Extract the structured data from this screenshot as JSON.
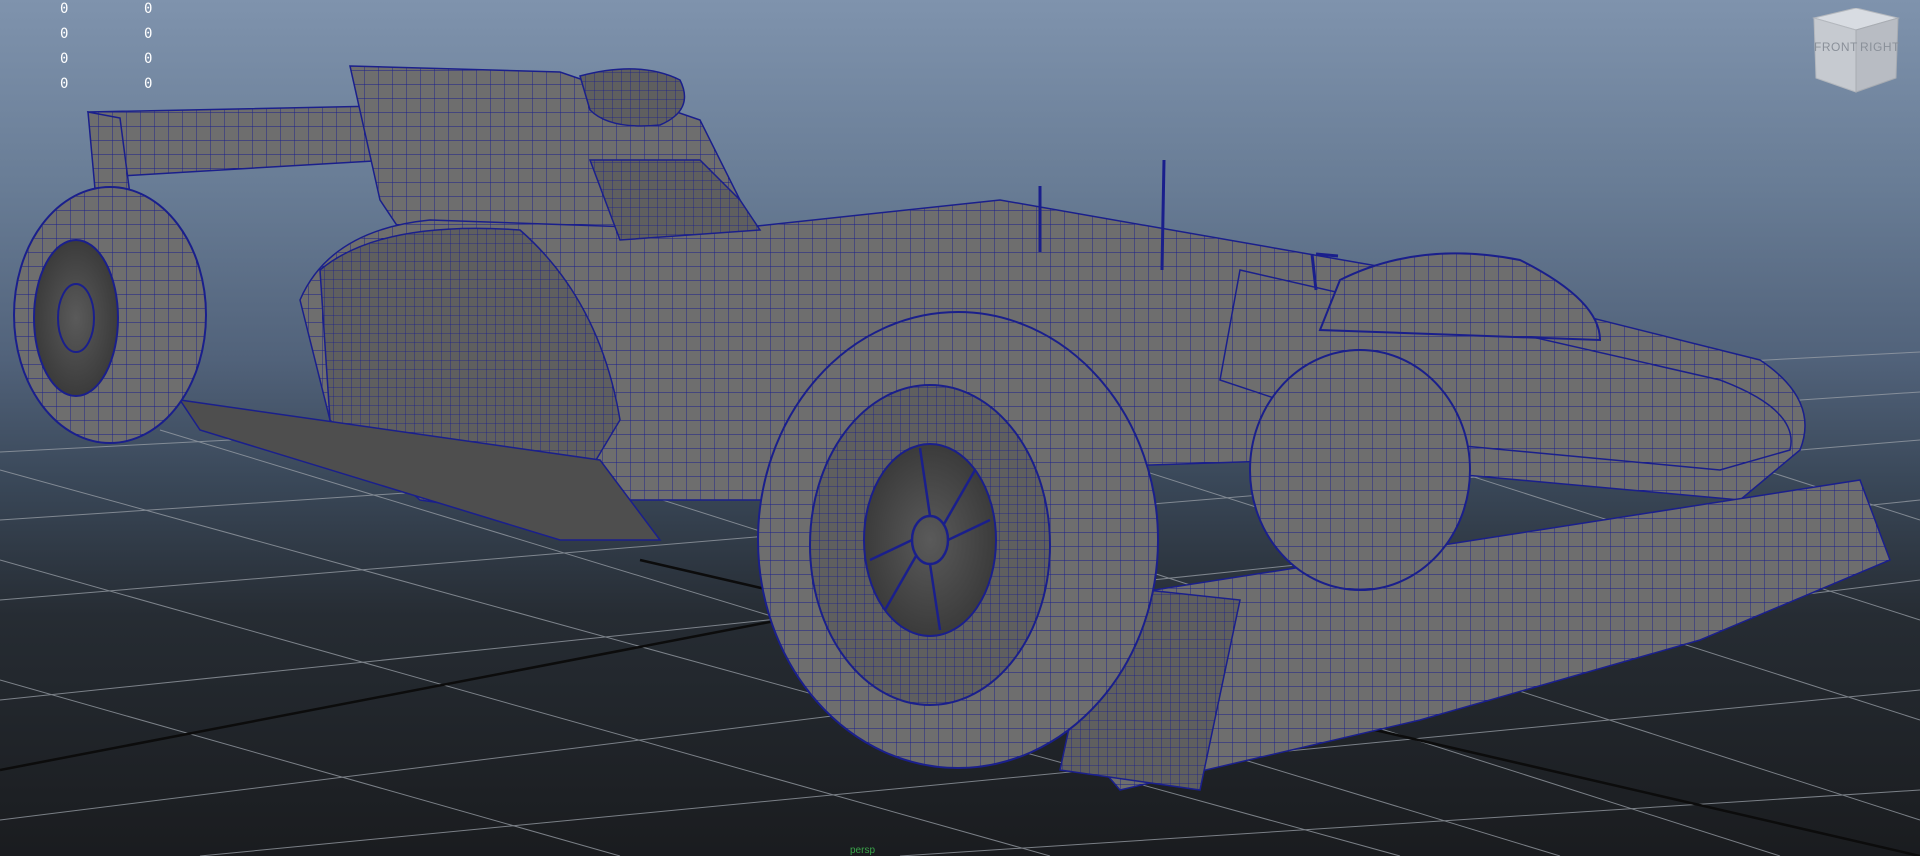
{
  "hud": {
    "rows": [
      {
        "a": "0",
        "b": "0"
      },
      {
        "a": "0",
        "b": "0"
      },
      {
        "a": "0",
        "b": "0"
      },
      {
        "a": "0",
        "b": "0"
      }
    ]
  },
  "viewcube": {
    "front_label": "FRONT",
    "right_label": "RIGHT"
  },
  "footer": {
    "label": "persp"
  },
  "colors": {
    "wire": "#1a1f8c",
    "body": "#6b6b6b",
    "grid": "#9aa0a8"
  }
}
